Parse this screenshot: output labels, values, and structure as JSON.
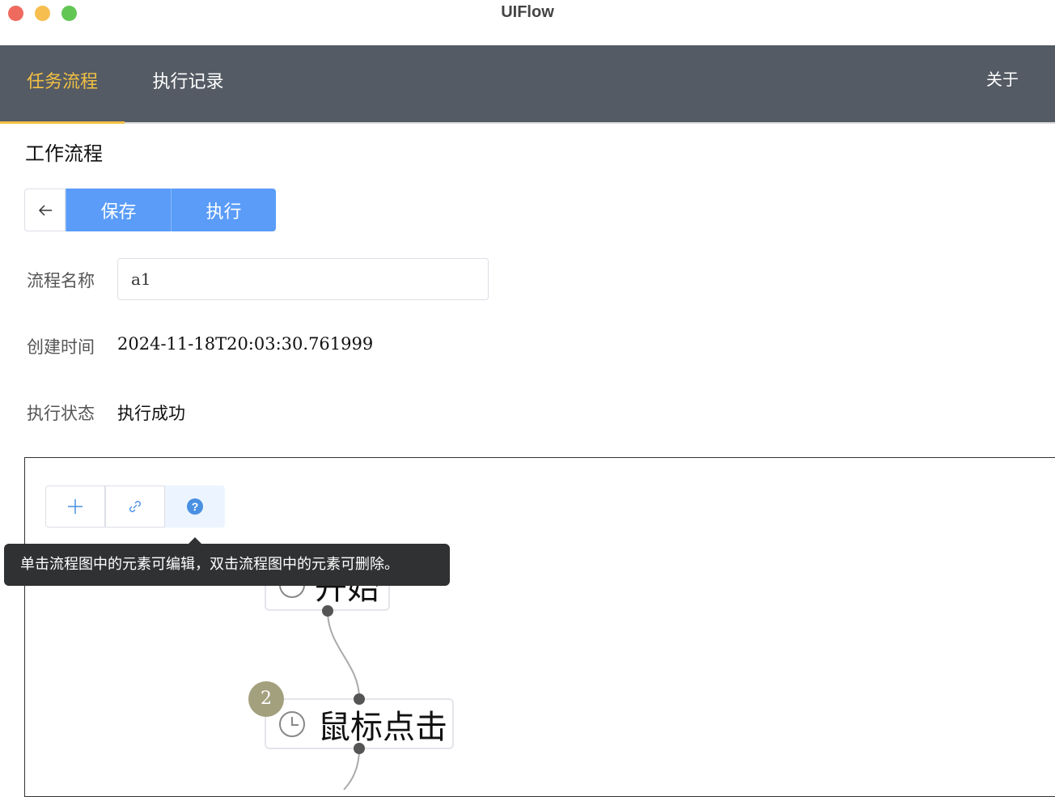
{
  "window": {
    "title": "UIFlow"
  },
  "nav": {
    "tabs": [
      {
        "label": "任务流程",
        "active": true
      },
      {
        "label": "执行记录",
        "active": false
      }
    ],
    "about": "关于"
  },
  "page": {
    "heading": "工作流程"
  },
  "toolbar": {
    "back_icon": "arrow-left-icon",
    "save_label": "保存",
    "run_label": "执行"
  },
  "form": {
    "name_label": "流程名称",
    "name_value": "a1",
    "created_label": "创建时间",
    "created_value": "2024-11-18T20:03:30.761999",
    "status_label": "执行状态",
    "status_value": "执行成功"
  },
  "flow": {
    "tools": [
      "plus-icon",
      "link-icon",
      "help-icon"
    ],
    "tooltip": "单击流程图中的元素可编辑，双击流程图中的元素可删除。",
    "nodes": [
      {
        "label": "开始",
        "icon": "circle-icon"
      },
      {
        "label": "鼠标点击",
        "icon": "clock-icon",
        "badge": "2"
      }
    ]
  },
  "colors": {
    "accent": "#f2c044",
    "primary": "#5a9cf8",
    "nav": "#545b64"
  }
}
